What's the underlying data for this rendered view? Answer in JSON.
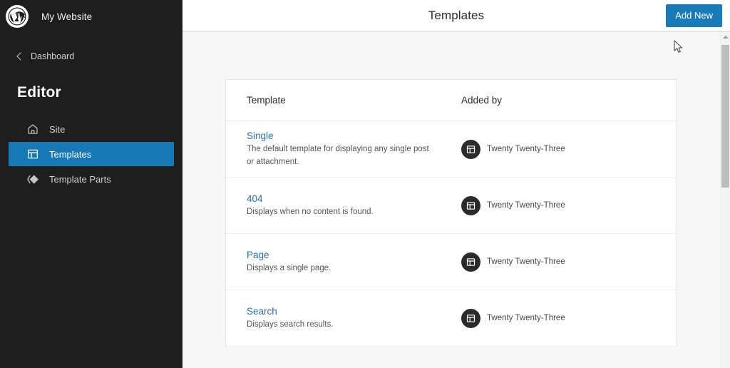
{
  "sidebar": {
    "logo_icon": "wordpress-logo-icon",
    "site_title": "My Website",
    "back_icon": "chevron-left-icon",
    "dashboard_label": "Dashboard",
    "section_title": "Editor",
    "items": [
      {
        "label": "Site",
        "icon": "home-icon",
        "selected": false
      },
      {
        "label": "Templates",
        "icon": "layout-icon",
        "selected": true
      },
      {
        "label": "Template Parts",
        "icon": "template-parts-icon",
        "selected": false
      }
    ]
  },
  "header": {
    "title": "Templates",
    "add_new_label": "Add New"
  },
  "table": {
    "columns": [
      "Template",
      "Added by"
    ],
    "rows": [
      {
        "name": "Single",
        "description": "The default template for displaying any single post or attachment.",
        "author": "Twenty Twenty-Three",
        "author_icon": "theme-avatar-icon"
      },
      {
        "name": "404",
        "description": "Displays when no content is found.",
        "author": "Twenty Twenty-Three",
        "author_icon": "theme-avatar-icon"
      },
      {
        "name": "Page",
        "description": "Displays a single page.",
        "author": "Twenty Twenty-Three",
        "author_icon": "theme-avatar-icon"
      },
      {
        "name": "Search",
        "description": "Displays search results.",
        "author": "Twenty Twenty-Three",
        "author_icon": "theme-avatar-icon"
      }
    ]
  },
  "scrollbar": {
    "up_arrow_icon": "scroll-up-arrow-icon"
  },
  "colors": {
    "sidebar_bg": "#1e1e1e",
    "accent_blue": "#1579b8",
    "button_blue": "#1a7bb9",
    "link_blue": "#2a6fa8",
    "content_bg": "#f7f7f7"
  }
}
